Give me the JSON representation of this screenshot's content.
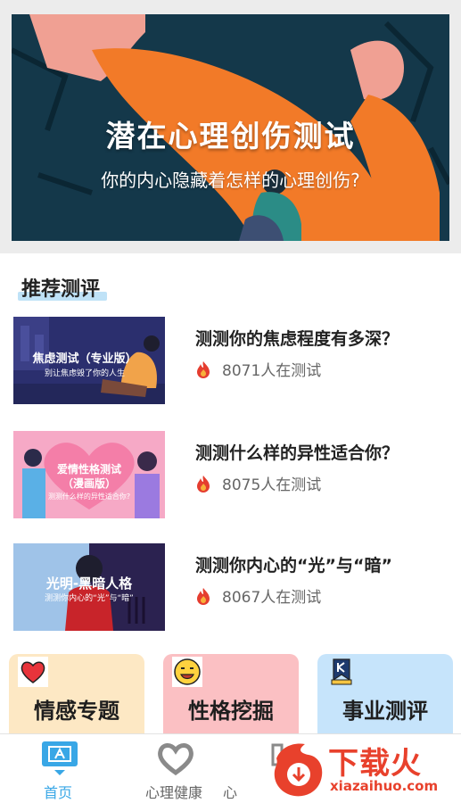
{
  "banner": {
    "title": "潜在心理创伤测试",
    "subtitle": "你的内心隐藏着怎样的心理创伤?"
  },
  "section": {
    "title": "推荐测评"
  },
  "items": [
    {
      "thumb_title": "焦虑测试（专业版）",
      "thumb_sub": "别让焦虑毁了你的人生",
      "title": "测测你的焦虑程度有多深？",
      "count": "8071人在测试"
    },
    {
      "thumb_title": "爱情性格测试",
      "thumb_title2": "（漫画版）",
      "thumb_sub": "测测什么样的异性适合你?",
      "title": "测测什么样的异性适合你？",
      "count": "8075人在测试"
    },
    {
      "thumb_title": "光明-黑暗人格",
      "thumb_sub": "测测你内心的“光”与“暗”",
      "title": "测测你内心的“光”与“暗”",
      "count": "8067人在测试"
    }
  ],
  "categories": [
    {
      "label": "情感专题",
      "icon": "heart-icon",
      "color": "#fde8c4"
    },
    {
      "label": "性格挖掘",
      "icon": "smiley-icon",
      "color": "#fbc0c3"
    },
    {
      "label": "事业测评",
      "icon": "bookmark-k-icon",
      "color": "#c6e4fb"
    }
  ],
  "tabs": [
    {
      "label": "首页",
      "icon": "home-monitor-icon",
      "active": true
    },
    {
      "label": "心理健康",
      "icon": "heart-outline-icon",
      "active": false
    },
    {
      "label": "心",
      "icon": "grid-icon",
      "active": false
    }
  ],
  "watermark": {
    "text": "下载火",
    "url": "xiazaihuo.com"
  },
  "colors": {
    "accent": "#39a7e6",
    "brand_red": "#e8412c",
    "banner_bg": "#14384a"
  }
}
